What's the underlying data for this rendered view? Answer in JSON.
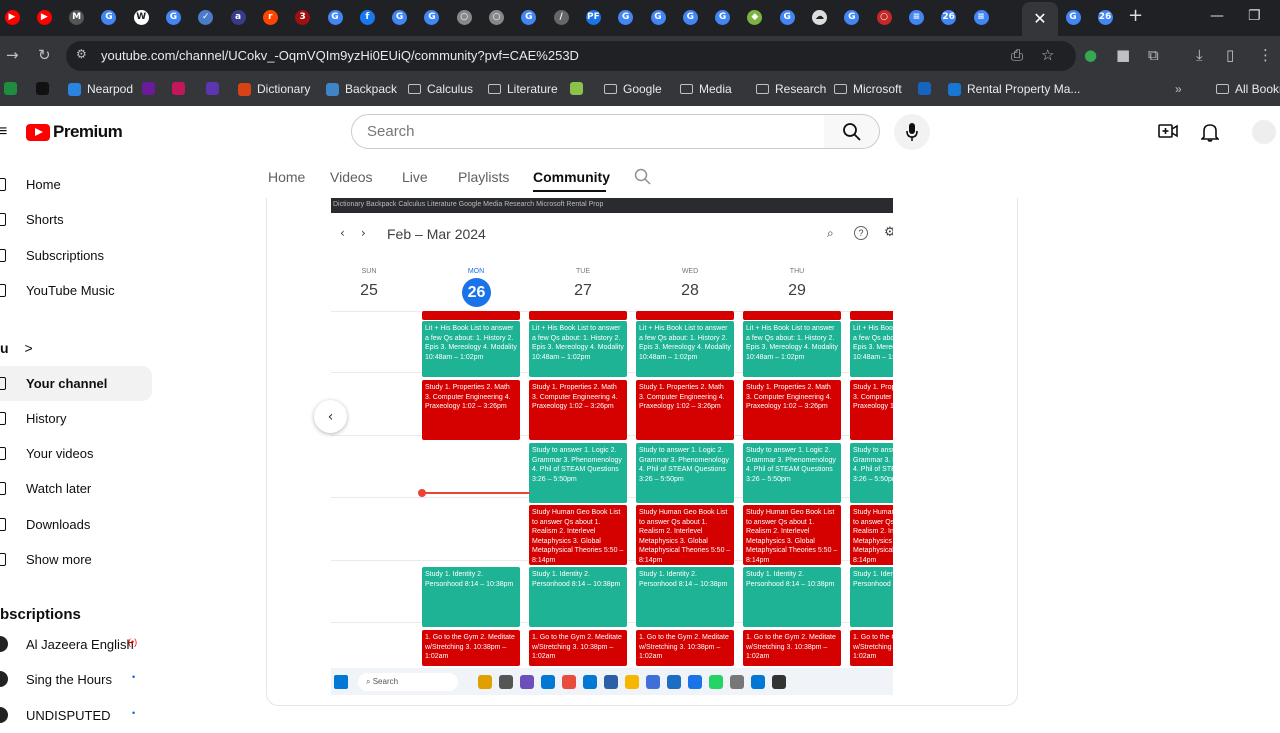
{
  "tabs": [
    {
      "icon": "youtube-tab-icon",
      "color": "#ff0000",
      "glyph": "▶"
    },
    {
      "icon": "youtube-tab-icon",
      "color": "#ff0000",
      "glyph": "▶"
    },
    {
      "icon": "mixed-tab-icon",
      "color": "#555",
      "glyph": "M"
    },
    {
      "icon": "chrome-tab-icon",
      "color": "#4285f4",
      "glyph": "G"
    },
    {
      "icon": "w-tab-icon",
      "color": "#fff",
      "glyph": "W"
    },
    {
      "icon": "chrome-tab-icon",
      "color": "#4285f4",
      "glyph": "G"
    },
    {
      "icon": "shield-tab-icon",
      "color": "#4a7cc7",
      "glyph": "✓"
    },
    {
      "icon": "ads-tab-icon",
      "color": "#3a3a8a",
      "glyph": "a"
    },
    {
      "icon": "reddit-tab-icon",
      "color": "#ff4500",
      "glyph": "r"
    },
    {
      "icon": "three-tab-icon",
      "color": "#a01010",
      "glyph": "3"
    },
    {
      "icon": "chrome-tab-icon",
      "color": "#4285f4",
      "glyph": "G"
    },
    {
      "icon": "facebook-tab-icon",
      "color": "#1877f2",
      "glyph": "f"
    },
    {
      "icon": "chrome-tab-icon",
      "color": "#4285f4",
      "glyph": "G"
    },
    {
      "icon": "chrome-tab-icon",
      "color": "#4285f4",
      "glyph": "G"
    },
    {
      "icon": "globe-tab-icon",
      "color": "#888",
      "glyph": "○"
    },
    {
      "icon": "globe-tab-icon",
      "color": "#888",
      "glyph": "○"
    },
    {
      "icon": "chrome-tab-icon",
      "color": "#4285f4",
      "glyph": "G"
    },
    {
      "icon": "slash-tab-icon",
      "color": "#666",
      "glyph": "/"
    },
    {
      "icon": "pf-tab-icon",
      "color": "#1a73e8",
      "glyph": "PF"
    },
    {
      "icon": "chrome-tab-icon",
      "color": "#4285f4",
      "glyph": "G"
    },
    {
      "icon": "chrome-tab-icon",
      "color": "#4285f4",
      "glyph": "G"
    },
    {
      "icon": "chrome-tab-icon",
      "color": "#4285f4",
      "glyph": "G"
    },
    {
      "icon": "chrome-tab-icon",
      "color": "#4285f4",
      "glyph": "G"
    },
    {
      "icon": "app-tab-icon",
      "color": "#7cb342",
      "glyph": "◆"
    },
    {
      "icon": "chrome-tab-icon",
      "color": "#4285f4",
      "glyph": "G"
    },
    {
      "icon": "cloud-tab-icon",
      "color": "#ddd",
      "glyph": "☁"
    },
    {
      "icon": "chrome-tab-icon",
      "color": "#4285f4",
      "glyph": "G"
    },
    {
      "icon": "circle-red-tab-icon",
      "color": "#c62828",
      "glyph": "○"
    },
    {
      "icon": "docs-tab-icon",
      "color": "#4285f4",
      "glyph": "≡"
    },
    {
      "icon": "calendar-tab-icon",
      "color": "#4285f4",
      "glyph": "26"
    },
    {
      "icon": "docs-tab-icon",
      "color": "#4285f4",
      "glyph": "≡"
    }
  ],
  "active_tab_glyph": "✕",
  "extra_tabs": [
    {
      "icon": "chrome-tab-icon",
      "color": "#4285f4",
      "glyph": "G"
    },
    {
      "icon": "calendar-tab-icon",
      "color": "#4285f4",
      "glyph": "26"
    }
  ],
  "new_tab_glyph": "+",
  "address": {
    "url": "youtube.com/channel/UCokv_-OqmVQIm9yzHi0EUiQ/community?pvf=CAE%253D"
  },
  "bookmarks": [
    {
      "label": "",
      "icon": "green-bookmark-icon",
      "color": "#1e8e3e"
    },
    {
      "label": "",
      "icon": "dark-bookmark-icon",
      "color": "#111"
    },
    {
      "label": "Nearpod",
      "icon": "nearpod-bookmark-icon",
      "color": "#2b84e0"
    },
    {
      "label": "",
      "icon": "purple-bookmark-icon",
      "color": "#6a1b9a"
    },
    {
      "label": "",
      "icon": "pink-bookmark-icon",
      "color": "#c2185b"
    },
    {
      "label": "",
      "icon": "blue-bookmark-icon",
      "color": "#5e35b1"
    },
    {
      "label": "Dictionary",
      "icon": "dictionary-bookmark-icon",
      "color": "#d84315"
    },
    {
      "label": "Backpack",
      "icon": "backpack-bookmark-icon",
      "color": "#3d85c6"
    },
    {
      "label": "Calculus",
      "icon": "folder-icon",
      "color": ""
    },
    {
      "label": "Literature",
      "icon": "folder-icon",
      "color": ""
    },
    {
      "label": "",
      "icon": "image-bookmark-icon",
      "color": "#8bc34a"
    },
    {
      "label": "Google",
      "icon": "folder-icon",
      "color": ""
    },
    {
      "label": "Media",
      "icon": "folder-icon",
      "color": ""
    },
    {
      "label": "Research",
      "icon": "folder-icon",
      "color": ""
    },
    {
      "label": "Microsoft",
      "icon": "folder-icon",
      "color": ""
    },
    {
      "label": "",
      "icon": "x-bookmark-icon",
      "color": "#1565c0"
    },
    {
      "label": "Rental Property Ma...",
      "icon": "shield-bookmark-icon",
      "color": "#1976d2"
    }
  ],
  "bookmarks_overflow": "»",
  "all_bookmarks": "All Bookn",
  "youtube": {
    "logo_text": "Premium",
    "search_placeholder": "Search"
  },
  "sidebar": {
    "items": [
      {
        "label": "Home",
        "name": "sidebar-item-home"
      },
      {
        "label": "Shorts",
        "name": "sidebar-item-shorts"
      },
      {
        "label": "Subscriptions",
        "name": "sidebar-item-subscriptions"
      },
      {
        "label": "YouTube Music",
        "name": "sidebar-item-youtube-music"
      }
    ],
    "you_header": "u",
    "you_chevron": ">",
    "you_items": [
      {
        "label": "Your channel",
        "name": "sidebar-item-your-channel",
        "active": true
      },
      {
        "label": "History",
        "name": "sidebar-item-history"
      },
      {
        "label": "Your videos",
        "name": "sidebar-item-your-videos"
      },
      {
        "label": "Watch later",
        "name": "sidebar-item-watch-later"
      },
      {
        "label": "Downloads",
        "name": "sidebar-item-downloads"
      },
      {
        "label": "Show more",
        "name": "sidebar-item-show-more"
      }
    ],
    "subs_header": "bscriptions",
    "subs": [
      {
        "label": "Al Jazeera English",
        "badge": "(•)"
      },
      {
        "label": "Sing the Hours",
        "badge": "•"
      },
      {
        "label": "UNDISPUTED",
        "badge": "•"
      }
    ]
  },
  "channel_tabs": [
    "Home",
    "Videos",
    "Live",
    "Playlists",
    "Community"
  ],
  "active_channel_tab": "Community",
  "post_image": {
    "mini_bookmarks": "Dictionary    Backpack    Calculus    Literature         Google    Media    Research    Microsoft    Rental Prop",
    "calendar_title": "Feb – Mar 2024",
    "days": [
      {
        "name": "SUN",
        "num": "25"
      },
      {
        "name": "MON",
        "num": "26"
      },
      {
        "name": "TUE",
        "num": "27"
      },
      {
        "name": "WED",
        "num": "28"
      },
      {
        "name": "THU",
        "num": "29"
      }
    ],
    "events": {
      "lit": "Lit + His Book List to answer a few Qs about: 1. History 2. Epis 3. Mereology 4. Modality 10:48am – 1:02pm",
      "study": "Study 1. Properties 2. Math 3. Computer Engineering 4. Praxeology 1:02 – 3:26pm",
      "logic": "Study to answer 1. Logic 2. Grammar 3. Phenomenology 4. Phil of STEAM Questions 3:26 – 5:50pm",
      "geo": "Study Human Geo Book List to answer Qs about 1. Realism 2. Interlevel Metaphysics 3. Global Metaphysical Theories 5:50 – 8:14pm",
      "identity": "Study 1. Identity 2. Personhood 8:14 – 10:38pm",
      "gym": "1. Go to the Gym 2. Meditate w/Stretching 3. 10:38pm – 1:02am"
    },
    "taskbar_search": "Search"
  }
}
